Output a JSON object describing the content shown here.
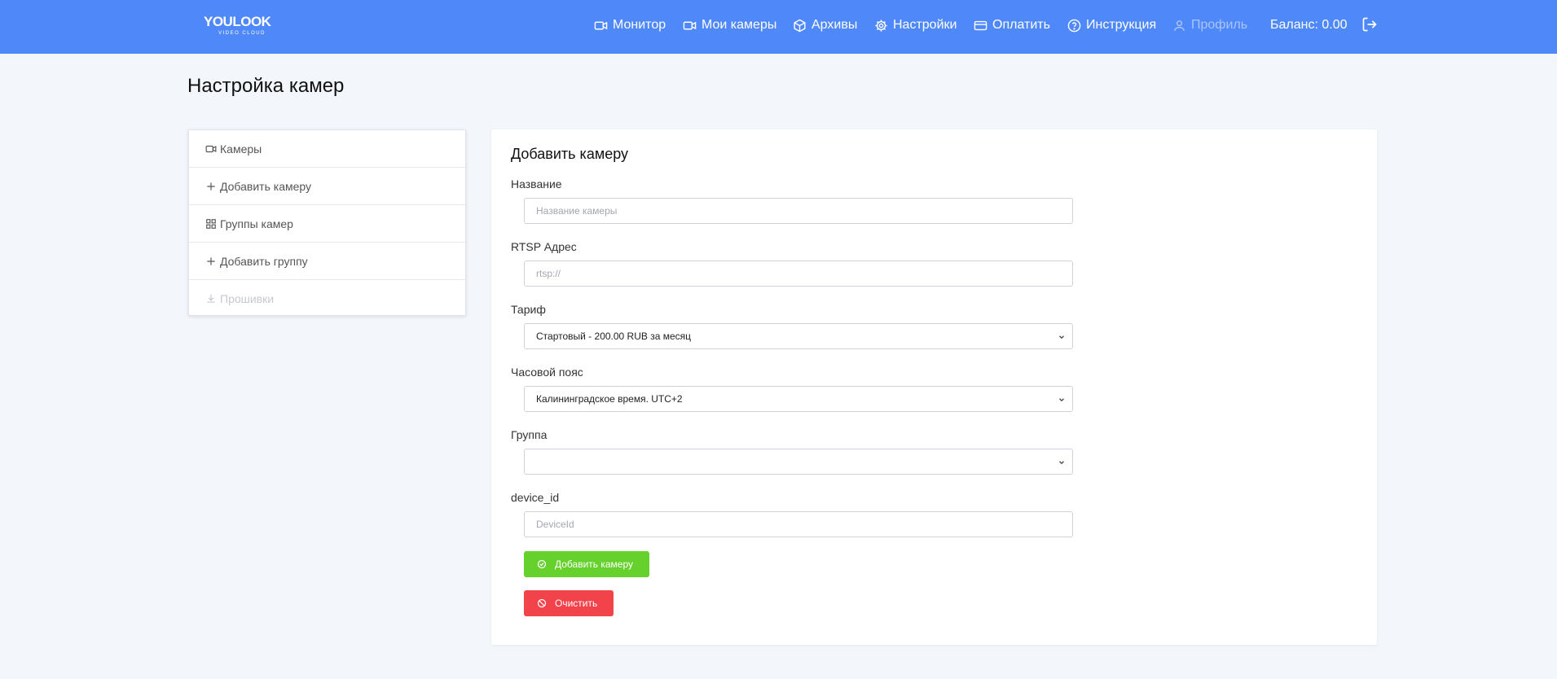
{
  "logo": {
    "main": "YOULOOK",
    "sub": "VIDEO CLOUD"
  },
  "nav": {
    "monitor": "Монитор",
    "my_cameras": "Мои камеры",
    "archives": "Архивы",
    "settings": "Настройки",
    "pay": "Оплатить",
    "instructions": "Инструкция",
    "profile": "Профиль"
  },
  "balance": "Баланс: 0.00",
  "page_title": "Настройка камер",
  "sidebar": {
    "items": [
      {
        "label": "Камеры",
        "icon": "video-icon"
      },
      {
        "label": "Добавить камеру",
        "icon": "plus-icon"
      },
      {
        "label": "Группы камер",
        "icon": "grid-icon"
      },
      {
        "label": "Добавить группу",
        "icon": "plus-icon"
      },
      {
        "label": "Прошивки",
        "icon": "download-icon",
        "disabled": true
      }
    ]
  },
  "form": {
    "title": "Добавить камеру",
    "name": {
      "label": "Название",
      "placeholder": "Название камеры",
      "value": ""
    },
    "rtsp": {
      "label": "RTSP Адрес",
      "placeholder": "rtsp://",
      "value": ""
    },
    "tariff": {
      "label": "Тариф",
      "selected": "Стартовый - 200.00 RUB за месяц"
    },
    "timezone": {
      "label": "Часовой пояс",
      "selected": "Калининградское время. UTC+2"
    },
    "group": {
      "label": "Группа",
      "selected": ""
    },
    "device_id": {
      "label": "device_id",
      "placeholder": "DeviceId",
      "value": ""
    },
    "add_button": "Добавить камеру",
    "clear_button": "Очистить"
  },
  "colors": {
    "header": "#4f88f8",
    "background": "#f3f6fb",
    "success": "#66d02d",
    "danger": "#f3434a"
  }
}
